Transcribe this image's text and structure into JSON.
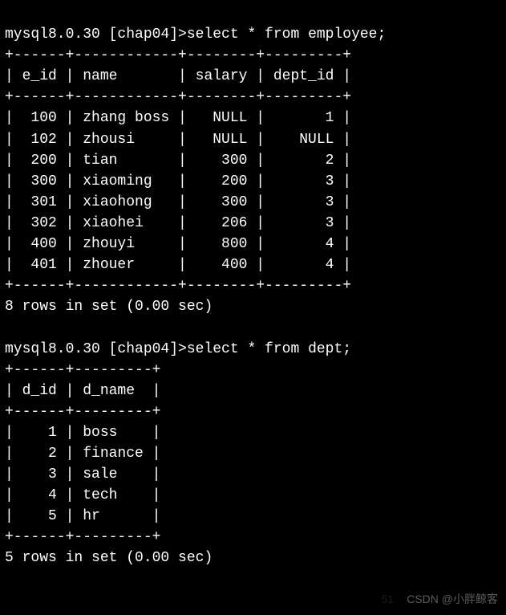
{
  "query1": {
    "prompt": "mysql8.0.30 [chap04]>",
    "command": "select * from employee;",
    "divider": "+------+------------+--------+---------+",
    "header": "| e_id | name       | salary | dept_id |",
    "rows": [
      "|  100 | zhang boss |   NULL |       1 |",
      "|  102 | zhousi     |   NULL |    NULL |",
      "|  200 | tian       |    300 |       2 |",
      "|  300 | xiaoming   |    200 |       3 |",
      "|  301 | xiaohong   |    300 |       3 |",
      "|  302 | xiaohei    |    206 |       3 |",
      "|  400 | zhouyi     |    800 |       4 |",
      "|  401 | zhouer     |    400 |       4 |"
    ],
    "footer": "8 rows in set (0.00 sec)"
  },
  "query2": {
    "prompt": "mysql8.0.30 [chap04]>",
    "command": "select * from dept;",
    "divider": "+------+---------+",
    "header": "| d_id | d_name  |",
    "rows": [
      "|    1 | boss    |",
      "|    2 | finance |",
      "|    3 | sale    |",
      "|    4 | tech    |",
      "|    5 | hr      |"
    ],
    "footer": "5 rows in set (0.00 sec)"
  },
  "chart_data": [
    {
      "type": "table",
      "title": "employee",
      "columns": [
        "e_id",
        "name",
        "salary",
        "dept_id"
      ],
      "rows": [
        [
          100,
          "zhang boss",
          null,
          1
        ],
        [
          102,
          "zhousi",
          null,
          null
        ],
        [
          200,
          "tian",
          300,
          2
        ],
        [
          300,
          "xiaoming",
          200,
          3
        ],
        [
          301,
          "xiaohong",
          300,
          3
        ],
        [
          302,
          "xiaohei",
          206,
          3
        ],
        [
          400,
          "zhouyi",
          800,
          4
        ],
        [
          401,
          "zhouer",
          400,
          4
        ]
      ]
    },
    {
      "type": "table",
      "title": "dept",
      "columns": [
        "d_id",
        "d_name"
      ],
      "rows": [
        [
          1,
          "boss"
        ],
        [
          2,
          "finance"
        ],
        [
          3,
          "sale"
        ],
        [
          4,
          "tech"
        ],
        [
          5,
          "hr"
        ]
      ]
    }
  ],
  "watermark": "CSDN @小胖鲸客",
  "watermark_faint": "51"
}
